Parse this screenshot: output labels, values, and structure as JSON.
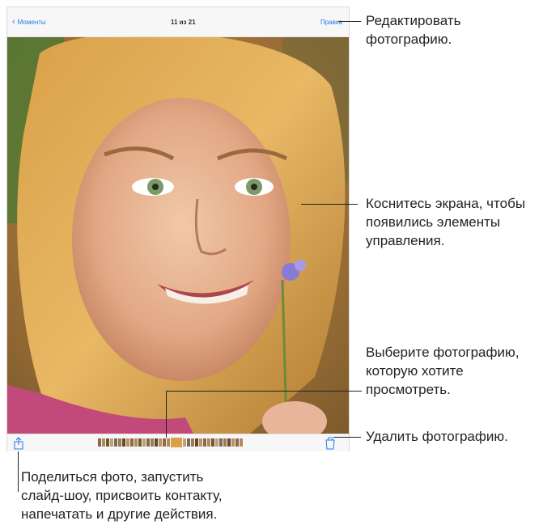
{
  "nav": {
    "back_label": "Моменты",
    "title": "11 из 21",
    "edit_label": "Правка"
  },
  "photo": {
    "description_icon": "portrait-photo"
  },
  "toolbar": {
    "share_icon": "share-icon",
    "trash_icon": "trash-icon"
  },
  "callouts": {
    "edit": [
      "Редактировать",
      "фотографию."
    ],
    "tap": [
      "Коснитесь экрана, чтобы",
      "появились элементы",
      "управления."
    ],
    "choose": [
      "Выберите фотографию,",
      "которую хотите",
      "просмотреть."
    ],
    "delete": [
      "Удалить фотографию."
    ],
    "share": [
      "Поделиться фото, запустить",
      "слайд-шоу, присвоить контакту,",
      "напечатать и другие действия."
    ]
  },
  "colors": {
    "accent": "#1a7ef0",
    "bar": "#f7f7f7"
  }
}
